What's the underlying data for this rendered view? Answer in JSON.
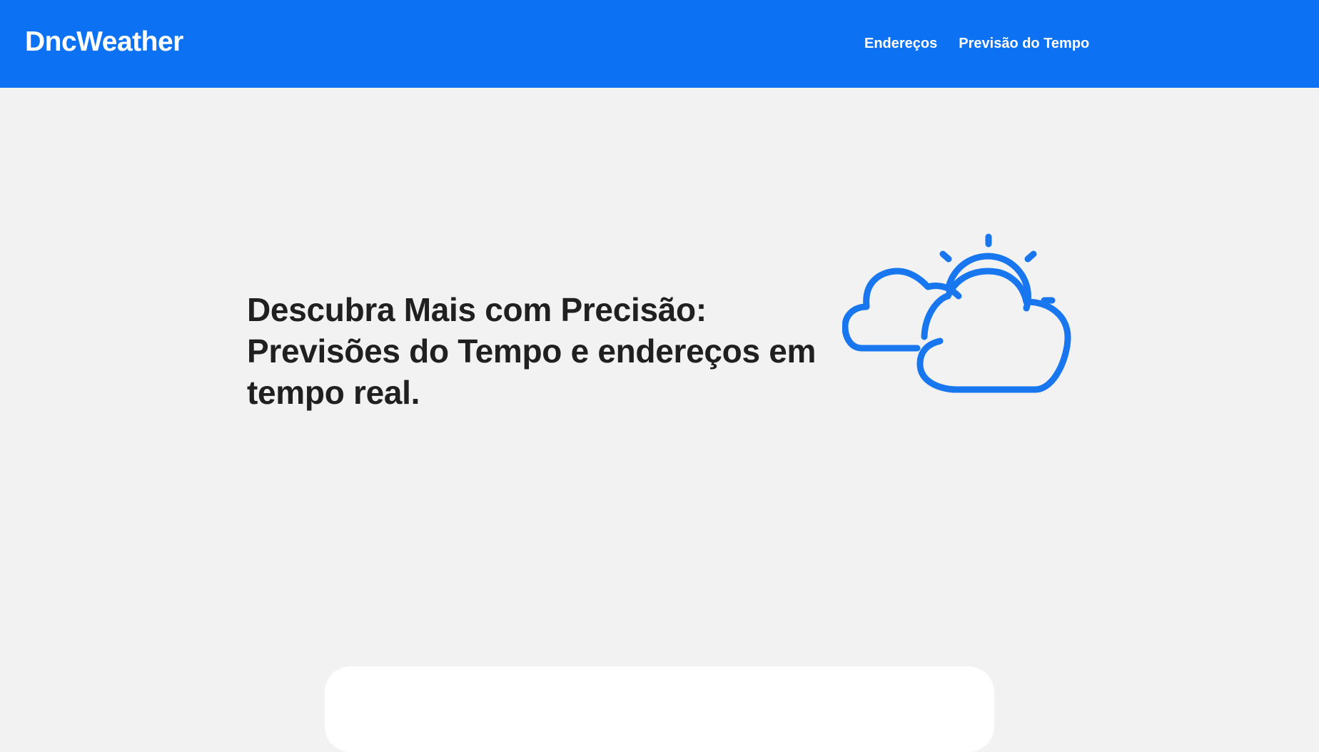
{
  "header": {
    "logo": "DncWeather",
    "nav": [
      {
        "label": "Endereços"
      },
      {
        "label": "Previsão do Tempo"
      }
    ]
  },
  "hero": {
    "title": "Descubra Mais com Precisão: Previsões do Tempo e endereços em tempo real.",
    "illustration_icon": "partly-cloudy-icon"
  },
  "colors": {
    "brand": "#0c71f2",
    "background": "#f2f2f2",
    "text": "#202020",
    "card": "#ffffff"
  }
}
